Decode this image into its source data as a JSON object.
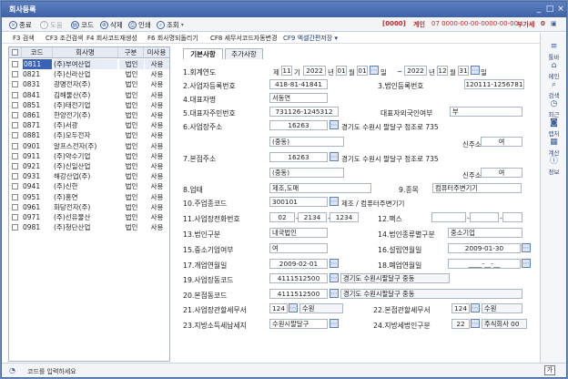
{
  "title": "회사등록",
  "window_controls": {
    "minimize": "_",
    "maximize": "□",
    "close": "×"
  },
  "toolbar": {
    "close": "종료",
    "help": "도움",
    "code": "코드",
    "delete": "삭제",
    "print": "인쇄",
    "search": "조회"
  },
  "status": {
    "code": "[0000]",
    "mode": "계인",
    "line": "07 0000-00-00-0000-00-00",
    "vat": "부가세",
    "num": "0"
  },
  "fkeys": [
    "F3 검색",
    "CF3 조건검색",
    "F4 회사코드재생성",
    "F6 회사명되돌리기",
    "CF8 세무서코드자동변경",
    "CF9 엑셀간편저장 ▾"
  ],
  "list": {
    "headers": [
      "코드",
      "회사명",
      "구분",
      "미사용"
    ],
    "rows": [
      {
        "code": "0811",
        "name": "(주)부여산업",
        "kind": "법인",
        "use": "사용",
        "sel": true
      },
      {
        "code": "0821",
        "name": "(주)신라산업",
        "kind": "법인",
        "use": "사용"
      },
      {
        "code": "0831",
        "name": "광명전자(주)",
        "kind": "법인",
        "use": "사용"
      },
      {
        "code": "0841",
        "name": "김해물산(주)",
        "kind": "법인",
        "use": "사용"
      },
      {
        "code": "0851",
        "name": "(주)태전기업",
        "kind": "법인",
        "use": "사용"
      },
      {
        "code": "0861",
        "name": "한양전기(주)",
        "kind": "법인",
        "use": "사용"
      },
      {
        "code": "0871",
        "name": "(주)서광",
        "kind": "법인",
        "use": "사용"
      },
      {
        "code": "0881",
        "name": "(주)모두전자",
        "kind": "법인",
        "use": "사용"
      },
      {
        "code": "0901",
        "name": "알프스전자(주)",
        "kind": "법인",
        "use": "사용"
      },
      {
        "code": "0911",
        "name": "(주)약수기업",
        "kind": "법인",
        "use": "사용"
      },
      {
        "code": "0921",
        "name": "(주)신일산업",
        "kind": "법인",
        "use": "사용"
      },
      {
        "code": "0931",
        "name": "해강산업(주)",
        "kind": "법인",
        "use": "사용"
      },
      {
        "code": "0941",
        "name": "(주)신한",
        "kind": "법인",
        "use": "사용"
      },
      {
        "code": "0951",
        "name": "(주)홍연",
        "kind": "법인",
        "use": "사용"
      },
      {
        "code": "0961",
        "name": "화당전자(주)",
        "kind": "법인",
        "use": "사용"
      },
      {
        "code": "0971",
        "name": "(주)선유물산",
        "kind": "법인",
        "use": "사용"
      },
      {
        "code": "0981",
        "name": "(주)청단산업",
        "kind": "법인",
        "use": "사용"
      }
    ]
  },
  "tabs": [
    "기본사항",
    "추가사항"
  ],
  "form": {
    "f1": "1.회계연도",
    "f1_je": "제",
    "f1_no": "11",
    "f1_gi": "기",
    "f1_y1": "2022",
    "f1_nyeon1": "년",
    "f1_m1": "01",
    "f1_wol1": "월",
    "f1_d1": "01",
    "f1_il1": "일",
    "f1_dash": "~",
    "f1_y2": "2022",
    "f1_nyeon2": "년",
    "f1_m2": "12",
    "f1_wol2": "월",
    "f1_d2": "31",
    "f1_il2": "일",
    "f2": "2.사업자등록번호",
    "f2_v": "418-81-41841",
    "f3": "3.법인등록번호",
    "f3_v": "120111-1256781",
    "f4": "4.대표자명",
    "f4_v": "서동연",
    "f5": "5.대표자주민번호",
    "f5_v": "731126-1245312",
    "f5b": "대표자외국인여부",
    "f5b_v": "부",
    "f6": "6.사업장주소",
    "f6_zip": "16263",
    "f6_addr": "경기도 수원시 팔달구 정조로 735",
    "f6_dong": "(중동)",
    "f6_new": "신주소",
    "f6_new_v": "여",
    "f7": "7.본점주소",
    "f7_zip": "16263",
    "f7_addr": "경기도 수원시 팔달구 정조로 735",
    "f7_dong": "(중동)",
    "f7_new": "신주소",
    "f7_new_v": "여",
    "f8": "8.업태",
    "f8_v": "제조,도매",
    "f9": "9.종목",
    "f9_v": "컴퓨터주변기기",
    "f10": "10.주업종코드",
    "f10_v": "300101",
    "f10_d": "제조 / 컴퓨터주변기기",
    "f11": "11.사업장전화번호",
    "f11_a": "02",
    "f11_b": "2134",
    "f11_c": "1234",
    "f12": "12.팩스",
    "f12_a": "",
    "f12_b": "",
    "f12_c": "",
    "f13": "13.법인구분",
    "f13_v": "내국법인",
    "f14": "14.법인종류별구분",
    "f14_v": "중소기업",
    "f15": "15.중소기업여부",
    "f15_v": "여",
    "f16": "16.설립연월일",
    "f16_v": "2009-01-30",
    "f17": "17.개업연월일",
    "f17_v": "2009-02-01",
    "f18": "18.폐업연월일",
    "f18_v": "____-__-__",
    "f19": "19.사업장동코드",
    "f19_v": "4111512500",
    "f19_d": "경기도 수원시팔달구 중동",
    "f20": "20.본점동코드",
    "f20_v": "4111512500",
    "f20_d": "경기도 수원시팔달구 중동",
    "f21": "21.사업장관할세무서",
    "f21_v": "124",
    "f21_d": "수원",
    "f22": "22.본점관할세무서",
    "f22_v": "124",
    "f22_d": "수원",
    "f23": "23.지방소득세납세지",
    "f23_v": "수원시팔달구",
    "f24": "24.지방세법인구분",
    "f24_v": "22",
    "f24_d": "주식회사 00"
  },
  "right": [
    {
      "icon": "≡",
      "label": "툴바"
    },
    {
      "icon": "⌂",
      "label": "메인"
    },
    {
      "icon": "⌕",
      "label": "검색"
    },
    {
      "icon": "◷",
      "label": "최근"
    },
    {
      "icon": "◙",
      "label": "캡처"
    },
    {
      "icon": "▦",
      "label": "계산"
    },
    {
      "icon": "ⓘ",
      "label": "정보"
    }
  ],
  "bottom": {
    "placeholder": "코드를 입력하세요",
    "key": "가"
  }
}
